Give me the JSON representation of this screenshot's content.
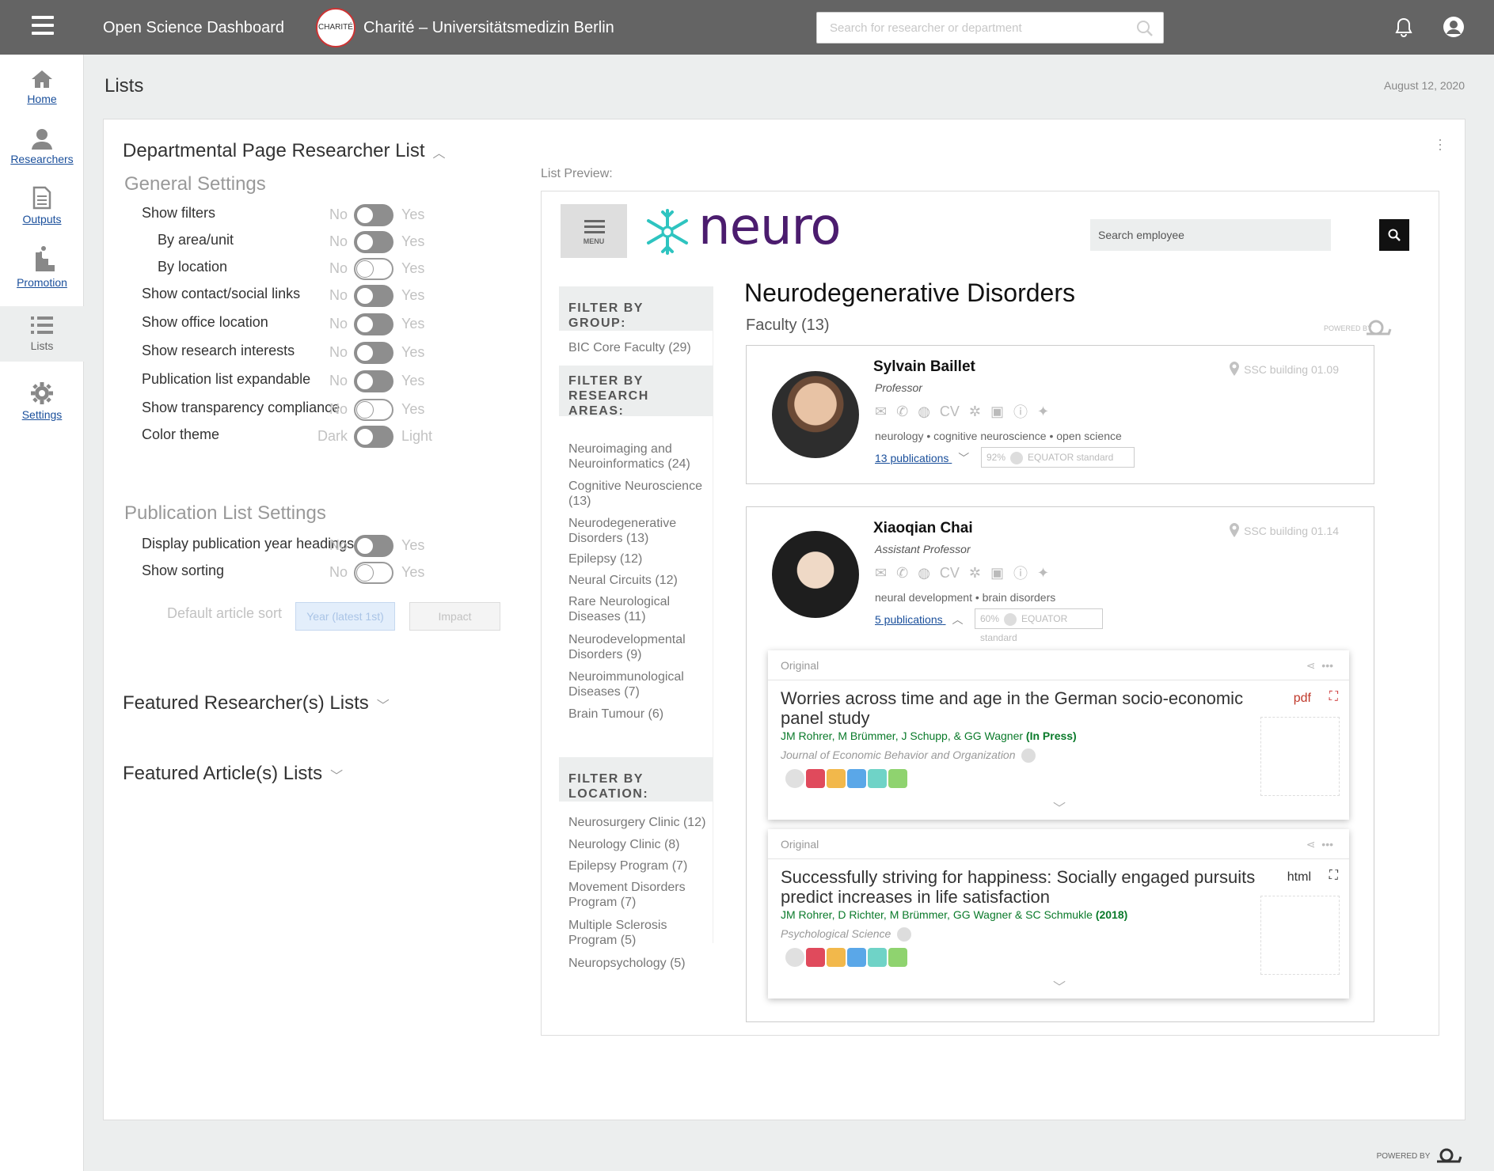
{
  "topbar": {
    "app_title": "Open Science Dashboard",
    "logo_text": "CHARITÉ",
    "institution": "Charité – Universitätsmedizin Berlin",
    "search_placeholder": "Search for researcher or department"
  },
  "sidebar": {
    "items": [
      {
        "label": "Home",
        "icon": "home-icon"
      },
      {
        "label": "Researchers",
        "icon": "user-icon"
      },
      {
        "label": "Outputs",
        "icon": "document-icon"
      },
      {
        "label": "Promotion",
        "icon": "stairs-icon"
      },
      {
        "label": "Lists",
        "icon": "list-icon"
      },
      {
        "label": "Settings",
        "icon": "gear-icon"
      }
    ]
  },
  "page": {
    "title": "Lists",
    "date": "August 12, 2020"
  },
  "editor": {
    "section_title": "Departmental Page Researcher List",
    "general_title": "General Settings",
    "settings": [
      {
        "label": "Show filters",
        "no": "No",
        "yes": "Yes",
        "state": "on"
      },
      {
        "label": "By area/unit",
        "no": "No",
        "yes": "Yes",
        "state": "on"
      },
      {
        "label": "By location",
        "no": "No",
        "yes": "Yes",
        "state": "off"
      },
      {
        "label": "Show contact/social links",
        "no": "No",
        "yes": "Yes",
        "state": "on"
      },
      {
        "label": "Show office location",
        "no": "No",
        "yes": "Yes",
        "state": "on"
      },
      {
        "label": "Show research interests",
        "no": "No",
        "yes": "Yes",
        "state": "on"
      },
      {
        "label": "Publication list expandable",
        "no": "No",
        "yes": "Yes",
        "state": "on"
      },
      {
        "label": "Show transparency compliance",
        "no": "No",
        "yes": "Yes",
        "state": "off"
      },
      {
        "label": "Color theme",
        "no": "Dark",
        "yes": "Light",
        "state": "on"
      }
    ],
    "pub_title": "Publication List Settings",
    "pub_settings": [
      {
        "label": "Display publication year headings",
        "no": "No",
        "yes": "Yes",
        "state": "on"
      },
      {
        "label": "Show sorting",
        "no": "No",
        "yes": "Yes",
        "state": "off"
      }
    ],
    "sort_label": "Default article sort",
    "sort_options": [
      "Year (latest 1st)",
      "Impact"
    ],
    "featured_researchers": "Featured Researcher(s) Lists",
    "featured_articles": "Featured Article(s) Lists"
  },
  "preview": {
    "label": "List Preview:",
    "menu_label": "MENU",
    "brand": "neuro",
    "search_placeholder": "Search employee",
    "filters": {
      "group_head": "FILTER BY GROUP:",
      "group_items": [
        "BIC Core Faculty (29)"
      ],
      "areas_head": "FILTER BY RESEARCH AREAS:",
      "area_items": [
        "Neuroimaging and Neuroinformatics (24)",
        "Cognitive Neuroscience (13)",
        "Neurodegenerative Disorders (13)",
        "Epilepsy (12)",
        "Neural Circuits (12)",
        "Rare Neurological Diseases (11)",
        "Neurodevelopmental Disorders (9)",
        "Neuroimmunological Diseases (7)",
        "Brain Tumour (6)"
      ],
      "location_head": "FILTER BY LOCATION:",
      "location_items": [
        "Neurosurgery Clinic (12)",
        "Neurology Clinic (8)",
        "Epilepsy Program (7)",
        "Movement Disorders Program (7)",
        "Multiple Sclerosis Program (5)",
        "Neuropsychology (5)"
      ]
    },
    "heading": "Neurodegenerative Disorders",
    "subheading": "Faculty (13)",
    "powered": "POWERED BY",
    "researchers": [
      {
        "name": "Sylvain Baillet",
        "role": "Professor",
        "location": "SSC building 01.09",
        "tags": "neurology • cognitive neuroscience • open science",
        "pubs": "13 publications",
        "eq_pct": "92%",
        "eq_label": "EQUATOR standard"
      },
      {
        "name": "Xiaoqian Chai",
        "role": "Assistant Professor",
        "location": "SSC building 01.14",
        "tags": "neural development • brain disorders",
        "pubs": "5 publications",
        "eq_pct": "60%",
        "eq_label": "EQUATOR standard"
      }
    ],
    "contact_icons": [
      "mail-icon",
      "phone-icon",
      "globe-icon",
      "cv-icon",
      "orcid-gear-icon",
      "google-scholar-icon",
      "id-icon",
      "twitter-icon"
    ],
    "cv_text": "CV",
    "publications": [
      {
        "kind": "Original",
        "title": "Worries across time and age in the German socio-economic panel study",
        "authors": "JM Rohrer, M Brümmer, J Schupp, & GG Wagner",
        "status": "(In Press)",
        "journal": "Journal of Economic Behavior and Organization",
        "type": "pdf",
        "type_color": "#c0392b"
      },
      {
        "kind": "Original",
        "title": "Successfully striving for happiness: Socially engaged pursuits predict increases in life satisfaction",
        "authors": "JM Rohrer, D Richter, M Brümmer, GG Wagner & SC Schmukle",
        "status": "(2018)",
        "journal": "Psychological Science",
        "type": "html",
        "type_color": "#333333"
      }
    ],
    "badge_colors": [
      "#e0e0e0",
      "#e04a5c",
      "#f2b84b",
      "#5aa7e8",
      "#6fd3c7",
      "#8fd36f"
    ]
  },
  "footer": {
    "powered": "POWERED BY"
  }
}
